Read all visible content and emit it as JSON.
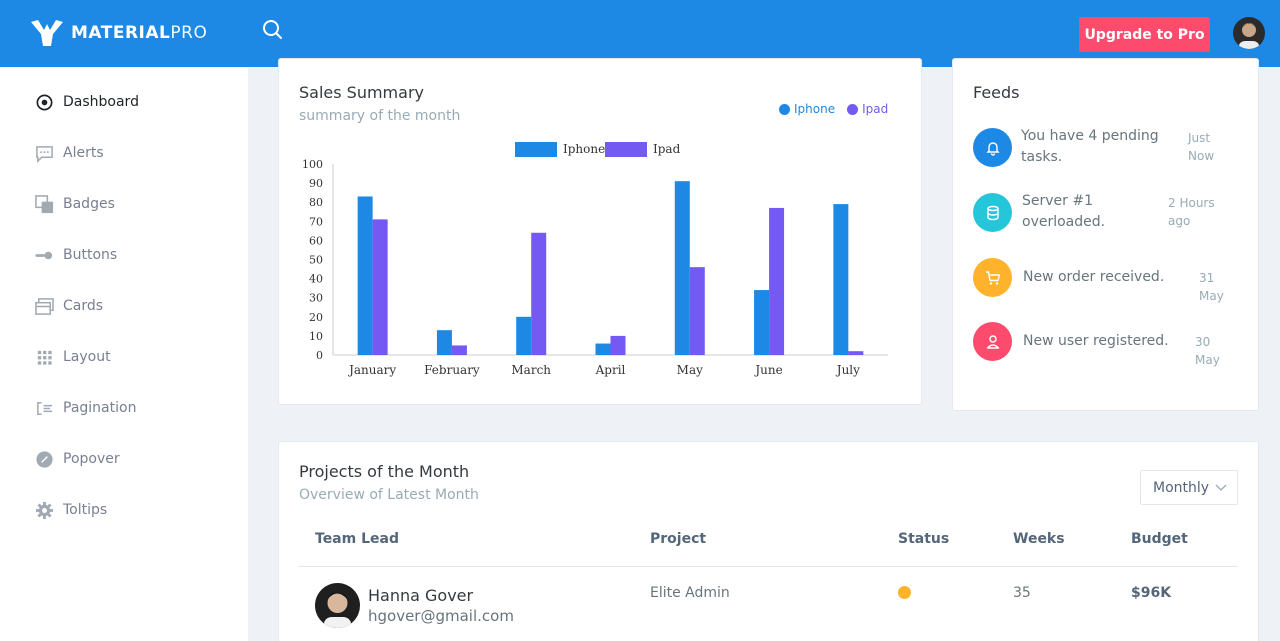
{
  "brand": {
    "name_bold": "MATERIAL",
    "name_light": "PRO",
    "color": "#1e88e5"
  },
  "header": {
    "upgrade_label": "Upgrade to Pro",
    "upgrade_color": "#fc4b6c"
  },
  "sidebar": {
    "items": [
      {
        "label": "Dashboard",
        "icon": "target-icon",
        "active": true
      },
      {
        "label": "Alerts",
        "icon": "chat-icon"
      },
      {
        "label": "Badges",
        "icon": "layers-icon"
      },
      {
        "label": "Buttons",
        "icon": "toggle-icon"
      },
      {
        "label": "Cards",
        "icon": "cards-icon"
      },
      {
        "label": "Layout",
        "icon": "grid-icon"
      },
      {
        "label": "Pagination",
        "icon": "list-icon"
      },
      {
        "label": "Popover",
        "icon": "compass-icon"
      },
      {
        "label": "Toltips",
        "icon": "gear-icon"
      }
    ]
  },
  "sales": {
    "title": "Sales Summary",
    "subtitle": "summary of the month",
    "legend": [
      {
        "label": "Iphone",
        "color": "#1e88e5"
      },
      {
        "label": "Ipad",
        "color": "#745af2"
      }
    ]
  },
  "chart_data": {
    "type": "bar",
    "categories": [
      "January",
      "February",
      "March",
      "April",
      "May",
      "June",
      "July"
    ],
    "series": [
      {
        "name": "Iphone",
        "values": [
          83,
          13,
          20,
          6,
          91,
          34,
          79
        ],
        "color": "#1e88e5"
      },
      {
        "name": "Ipad",
        "values": [
          71,
          5,
          64,
          10,
          46,
          77,
          2
        ],
        "color": "#745af2"
      }
    ],
    "ylim": [
      0,
      100
    ],
    "yticks": [
      0,
      10,
      20,
      30,
      40,
      50,
      60,
      70,
      80,
      90,
      100
    ],
    "grid": false,
    "legend_position": "top-center"
  },
  "feeds": {
    "title": "Feeds",
    "items": [
      {
        "text_l1": "You have 4 pending",
        "text_l2": "tasks.",
        "time_l1": "Just",
        "time_l2": "Now",
        "icon": "bell-icon",
        "color": "#1e88e5"
      },
      {
        "text_l1": "Server #1",
        "text_l2": "overloaded.",
        "time_l1": "2 Hours",
        "time_l2": "ago",
        "icon": "database-icon",
        "color": "#26c6da"
      },
      {
        "text_l1": "New order received.",
        "text_l2": "",
        "time_l1": "31 May",
        "time_l2": "",
        "icon": "cart-icon",
        "color": "#ffb22b"
      },
      {
        "text_l1": "New user registered.",
        "text_l2": "",
        "time_l1": "30 May",
        "time_l2": "",
        "icon": "user-icon",
        "color": "#fc4b6c"
      }
    ]
  },
  "projects": {
    "title": "Projects of the Month",
    "subtitle": "Overview of Latest Month",
    "filter": "Monthly",
    "columns": [
      "Team Lead",
      "Project",
      "Status",
      "Weeks",
      "Budget"
    ],
    "rows": [
      {
        "name": "Hanna Gover",
        "email": "hgover@gmail.com",
        "project": "Elite Admin",
        "status_color": "#ffb22b",
        "weeks": "35",
        "budget": "$96K"
      }
    ]
  }
}
